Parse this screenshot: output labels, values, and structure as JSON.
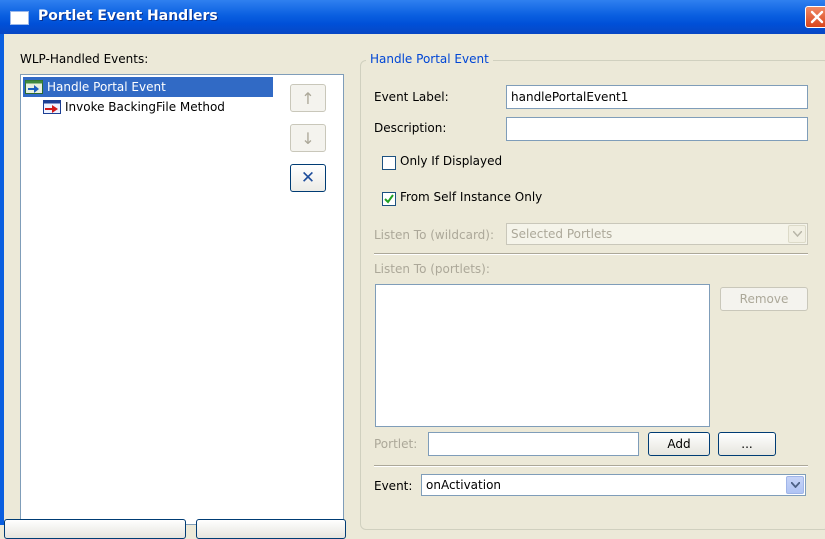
{
  "window": {
    "title": "Portlet Event Handlers"
  },
  "left_panel": {
    "header": "WLP-Handled Events:",
    "tree_items": [
      {
        "label": "Handle Portal Event",
        "selected": true,
        "icon": "portal-event-icon"
      },
      {
        "label": "Invoke BackingFile Method",
        "selected": false,
        "icon": "backing-file-method-icon"
      }
    ]
  },
  "side_buttons": {
    "move_up": "↑",
    "move_down": "↓",
    "delete": "✕"
  },
  "group": {
    "legend": "Handle Portal Event",
    "event_label_label": "Event Label:",
    "event_label_value": "handlePortalEvent1",
    "description_label": "Description:",
    "description_value": "",
    "only_if_displayed_label": "Only If Displayed",
    "only_if_displayed_checked": false,
    "from_self_instance_label": "From Self Instance Only",
    "from_self_instance_checked": true,
    "listen_wildcard_label": "Listen To (wildcard):",
    "listen_wildcard_value": "Selected Portlets",
    "listen_portlets_label": "Listen To (portlets):",
    "remove_button": "Remove",
    "portlet_label": "Portlet:",
    "portlet_value": "",
    "add_button": "Add",
    "browse_button": "...",
    "event_label": "Event:",
    "event_value": "onActivation"
  },
  "colors": {
    "title_bar": "#0a5fe0",
    "selection": "#316ac5",
    "legend_text": "#0046d5",
    "disabled_text": "#aca899"
  }
}
